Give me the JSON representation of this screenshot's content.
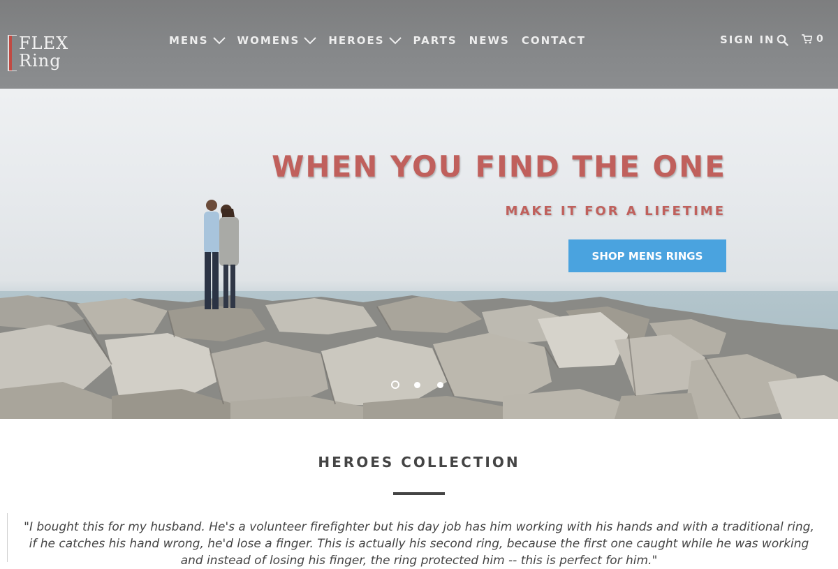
{
  "brand": {
    "logo_line1": "FLEX",
    "logo_line2": "Ring",
    "accent_color": "#c04a43"
  },
  "nav": {
    "items": [
      {
        "label": "MENS",
        "has_dropdown": true
      },
      {
        "label": "WOMENS",
        "has_dropdown": true
      },
      {
        "label": "HEROES",
        "has_dropdown": true
      },
      {
        "label": "PARTS",
        "has_dropdown": false
      },
      {
        "label": "NEWS",
        "has_dropdown": false
      },
      {
        "label": "CONTACT",
        "has_dropdown": false
      }
    ],
    "sign_in": "SIGN IN",
    "search_icon": "search-icon",
    "cart_icon": "cart-icon",
    "cart_count": "0"
  },
  "hero": {
    "title": "WHEN YOU FIND THE ONE",
    "subtitle": "MAKE IT FOR A LIFETIME",
    "button_label": "SHOP MENS RINGS",
    "title_color": "#c0605c",
    "button_color": "#4aa3df",
    "slides_total": 3,
    "active_slide": 1
  },
  "collection": {
    "title": "HEROES COLLECTION",
    "quote": "\"I bought this for my husband. He's a volunteer firefighter but his day job has him working with his hands and with a traditional ring, if he catches his hand wrong, he'd lose a finger. This is actually his second ring, because the first one caught while he was working and instead of losing his finger, the ring protected him -- this is perfect for him.\""
  }
}
